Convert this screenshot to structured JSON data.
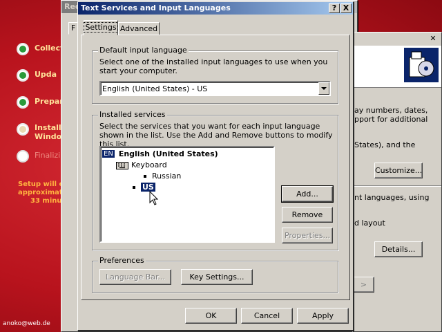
{
  "setup": {
    "steps": [
      {
        "label": "Collect",
        "state": "done"
      },
      {
        "label": "Upda",
        "state": "done"
      },
      {
        "label": "Prepar",
        "state": "done"
      },
      {
        "label": "Install",
        "label2": "Windo",
        "state": "current"
      },
      {
        "label": "Finalizi",
        "state": "todo"
      }
    ],
    "eta_line1": "Setup will c",
    "eta_line2": "approximat",
    "eta_line3": "33 minu"
  },
  "credit": "anoko@web.de",
  "back_window": {
    "title": "Rec",
    "tab": "F"
  },
  "right_window": {
    "text1": "ay numbers, dates,",
    "text2": "pport for additional",
    "text3": "States), and the",
    "customize_label": "Customize...",
    "text4": "nt languages, using",
    "text5": "d layout",
    "details_label": "Details...",
    "arrow_label": ">"
  },
  "dialog": {
    "title": "Text Services and Input Languages",
    "help_btn": "?",
    "close_btn": "X",
    "tabs": [
      "Settings",
      "Advanced"
    ],
    "default_group": "Default input language",
    "default_desc": "Select one of the installed input languages to use when you start your computer.",
    "default_value": "English (United States) - US",
    "installed_group": "Installed services",
    "installed_desc": "Select the services that you want for each input language shown in the list. Use the Add and Remove buttons to modify this list.",
    "tree": {
      "lang_badge": "EN",
      "lang": "English (United States)",
      "category": "Keyboard",
      "items": [
        "Russian",
        "US"
      ]
    },
    "add_label": "Add...",
    "remove_label": "Remove",
    "properties_label": "Properties...",
    "prefs_group": "Preferences",
    "langbar_label": "Language Bar...",
    "keysettings_label": "Key Settings...",
    "ok_label": "OK",
    "cancel_label": "Cancel",
    "apply_label": "Apply"
  }
}
